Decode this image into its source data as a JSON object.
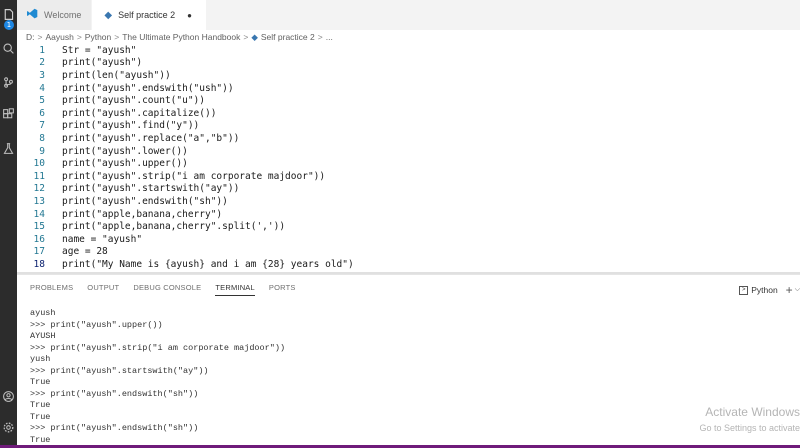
{
  "tabs": [
    {
      "label": "Welcome",
      "icon": "vscode-icon",
      "active": false
    },
    {
      "label": "Self practice 2",
      "icon": "python-file-icon",
      "active": true,
      "modified_indicator": "●"
    }
  ],
  "breadcrumb": {
    "parts": [
      "D:",
      "Aayush",
      "Python",
      "The Ultimate Python Handbook",
      "Self practice 2",
      "..."
    ],
    "separator": ">"
  },
  "activity_badge": "1",
  "code_lines": [
    {
      "num": "1",
      "text": "Str = \"ayush\""
    },
    {
      "num": "2",
      "text": "print(\"ayush\")"
    },
    {
      "num": "3",
      "text": "print(len(\"ayush\"))"
    },
    {
      "num": "4",
      "text": "print(\"ayush\".endswith(\"ush\"))"
    },
    {
      "num": "5",
      "text": "print(\"ayush\".count(\"u\"))"
    },
    {
      "num": "6",
      "text": "print(\"ayush\".capitalize())"
    },
    {
      "num": "7",
      "text": "print(\"ayush\".find(\"y\"))"
    },
    {
      "num": "8",
      "text": "print(\"ayush\".replace(\"a\",\"b\"))"
    },
    {
      "num": "9",
      "text": "print(\"ayush\".lower())"
    },
    {
      "num": "10",
      "text": "print(\"ayush\".upper())"
    },
    {
      "num": "11",
      "text": "print(\"ayush\".strip(\"i am corporate majdoor\"))"
    },
    {
      "num": "12",
      "text": "print(\"ayush\".startswith(\"ay\"))"
    },
    {
      "num": "13",
      "text": "print(\"ayush\".endswith(\"sh\"))"
    },
    {
      "num": "14",
      "text": "print(\"apple,banana,cherry\")"
    },
    {
      "num": "15",
      "text": "print(\"apple,banana,cherry\".split(','))"
    },
    {
      "num": "16",
      "text": "name = \"ayush\""
    },
    {
      "num": "17",
      "text": "age = 28"
    },
    {
      "num": "18",
      "text": "print(\"My Name is {ayush} and i am {28} years old\")"
    }
  ],
  "panel": {
    "tabs": [
      "PROBLEMS",
      "OUTPUT",
      "DEBUG CONSOLE",
      "TERMINAL",
      "PORTS"
    ],
    "active_tab": "TERMINAL",
    "shell_label": "Python",
    "shell_icon": "terminal-icon",
    "plus": "+",
    "chevron": "⌵"
  },
  "terminal_lines": [
    "ayush",
    ">>> print(\"ayush\".upper())",
    "AYUSH",
    ">>> print(\"ayush\".strip(\"i am corporate majdoor\"))",
    "yush",
    ">>> print(\"ayush\".startswith(\"ay\"))",
    "True",
    ">>> print(\"ayush\".endswith(\"sh\"))",
    "True",
    "True",
    ">>> print(\"ayush\".endswith(\"sh\"))",
    "True"
  ],
  "watermark": {
    "title": "Activate Windows",
    "subtitle": "Go to Settings to activate"
  },
  "colors": {
    "activity_bar": "#2c2c2c",
    "badge": "#1e88e5",
    "line_numbers": "#237893",
    "bottom_bar": "#6f1b7a"
  }
}
